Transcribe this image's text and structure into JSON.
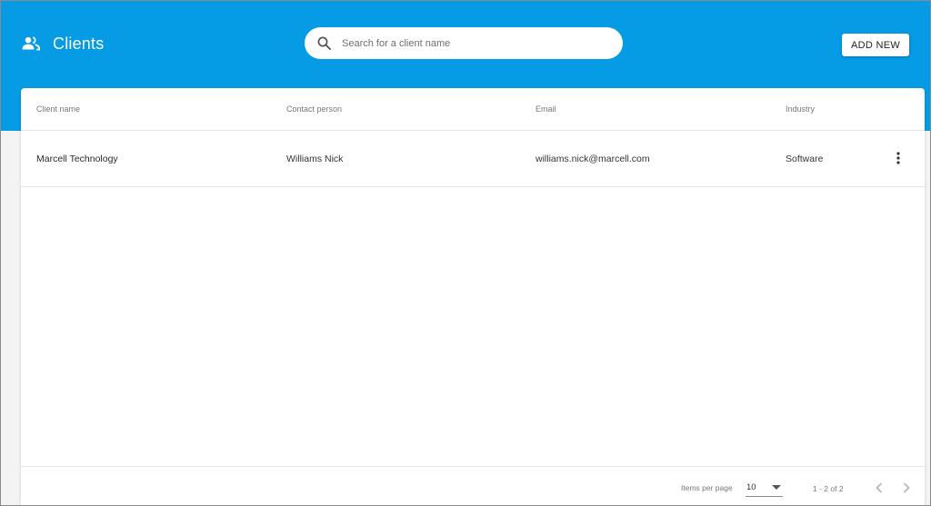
{
  "header": {
    "title": "Clients",
    "title_icon": "people-icon",
    "search": {
      "placeholder": "Search for a client name",
      "value": "",
      "icon": "search-icon"
    },
    "add_button_label": "ADD NEW"
  },
  "table": {
    "columns": [
      "Client name",
      "Contact person",
      "Email",
      "Industry"
    ],
    "rows": [
      {
        "client_name": "Marcell Technology",
        "contact_person": "Williams Nick",
        "email": "williams.nick@marcell.com",
        "industry": "Software",
        "action_icon": "more-vert-icon"
      }
    ]
  },
  "pagination": {
    "items_per_page_label": "Items per page",
    "items_per_page_value": "10",
    "range_label": "1 - 2 of 2",
    "prev_icon": "chevron-left-icon",
    "next_icon": "chevron-right-icon"
  },
  "colors": {
    "header_bg": "#059be5",
    "page_bg": "#f3f3f3",
    "card_bg": "#ffffff"
  }
}
